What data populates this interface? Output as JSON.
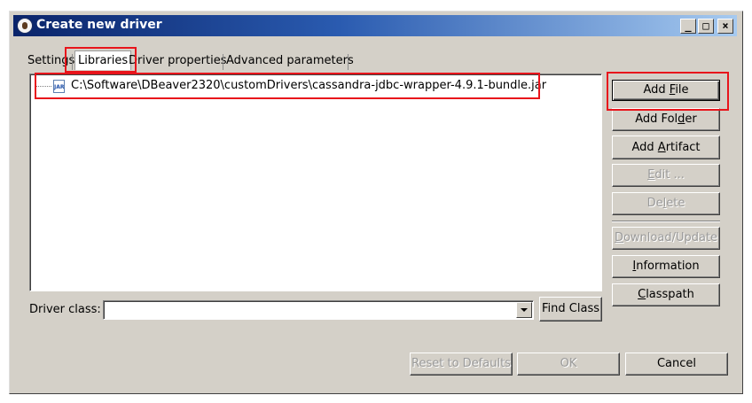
{
  "window": {
    "title": "Create new driver",
    "controls": {
      "minimize": "_",
      "maximize": "□",
      "close": "×"
    }
  },
  "tabs": [
    {
      "label": "Settings"
    },
    {
      "label": "Libraries"
    },
    {
      "label": "Driver properties"
    },
    {
      "label": "Advanced parameters"
    }
  ],
  "active_tab": "Libraries",
  "libraries": {
    "items": [
      {
        "path": "C:\\Software\\DBeaver2320\\customDrivers\\cassandra-jdbc-wrapper-4.9.1-bundle.jar",
        "icon": "jar-file-icon",
        "icon_text": "JAR"
      }
    ]
  },
  "side_buttons": {
    "add_file": {
      "pre": "Add ",
      "acc": "F",
      "post": "ile"
    },
    "add_folder": {
      "pre": "Add Fol",
      "acc": "d",
      "post": "er"
    },
    "add_artifact": {
      "pre": "Add ",
      "acc": "A",
      "post": "rtifact"
    },
    "edit": {
      "pre": "",
      "acc": "E",
      "post": "dit ..."
    },
    "delete": {
      "pre": "De",
      "acc": "l",
      "post": "ete"
    },
    "download_update": {
      "pre": "",
      "acc": "D",
      "post": "ownload/Update"
    },
    "information": {
      "pre": "",
      "acc": "I",
      "post": "nformation"
    },
    "classpath": {
      "pre": "",
      "acc": "C",
      "post": "lasspath"
    }
  },
  "driver_class": {
    "label": "Driver class:",
    "value": "",
    "find_label": "Find Class"
  },
  "footer": {
    "reset_label": "Reset to Defaults",
    "ok_label": "OK",
    "cancel_label": "Cancel"
  },
  "colors": {
    "highlight": "#e8141b",
    "title_start": "#0a246a",
    "title_end": "#a6caf0",
    "face": "#d4d0c8"
  }
}
